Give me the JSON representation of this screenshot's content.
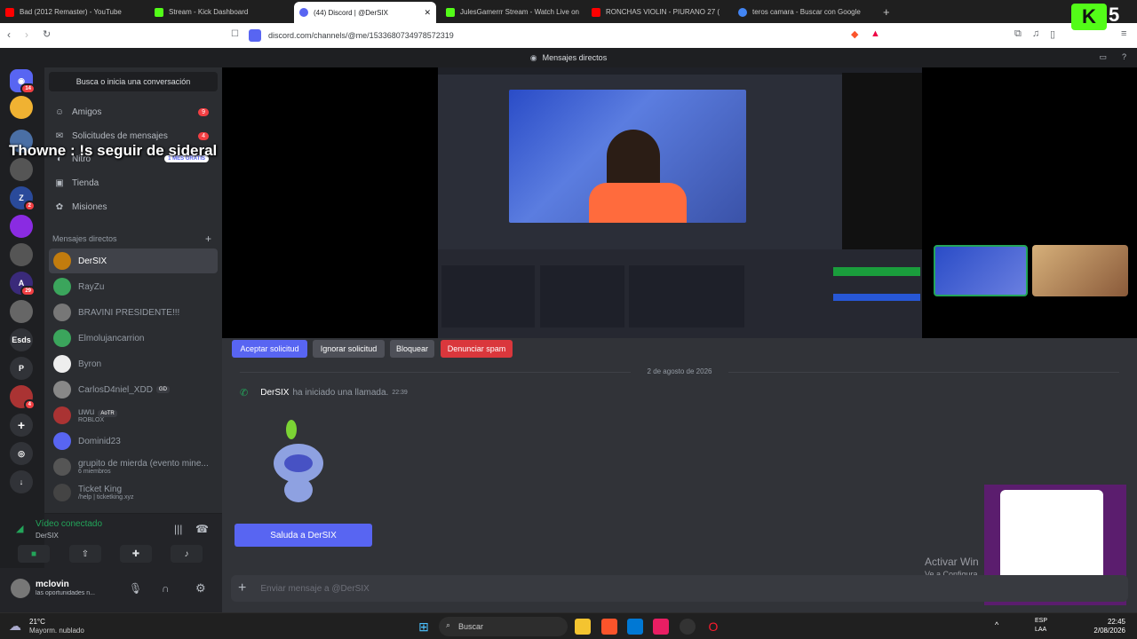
{
  "browser": {
    "tabs": [
      {
        "title": "Bad (2012 Remaster) - YouTube",
        "color": "#ff0000"
      },
      {
        "title": "Stream - Kick Dashboard",
        "color": "#53fc18"
      },
      {
        "title": "(44) Discord | @DerSIX",
        "color": "#5865f2",
        "active": true
      },
      {
        "title": "JulesGamerrr Stream - Watch Live on",
        "color": "#53fc18"
      },
      {
        "title": "RONCHAS VIOLIN - PIURANO 27 (",
        "color": "#ff0000"
      },
      {
        "title": "teros camara - Buscar con Google",
        "color": "#4285f4"
      }
    ],
    "new_tab": "+",
    "url": "discord.com/channels/@me/1533680734978572319"
  },
  "discord": {
    "title": "Mensajes directos",
    "search": "Busca o inicia una conversación",
    "nav": {
      "friends": "Amigos",
      "friends_count": "9",
      "requests": "Solicitudes de mensajes",
      "requests_count": "4",
      "nitro": "Nitro",
      "nitro_badge": "1 MES GRATIS",
      "shop": "Tienda",
      "missions": "Misiones"
    },
    "dm_header": "Mensajes directos",
    "dms": [
      {
        "name": "DerSIX",
        "selected": true,
        "color": "#c27c0e"
      },
      {
        "name": "RayZu",
        "color": "#3ba55c"
      },
      {
        "name": "BRAVINI PRESIDENTE!!!",
        "color": "#777"
      },
      {
        "name": "Elmolujancarrion",
        "color": "#3ba55c"
      },
      {
        "name": "Byron",
        "color": "#eee"
      },
      {
        "name": "CarlosD4niel_XDD",
        "tag": "GD",
        "color": "#888"
      },
      {
        "name": "uwu",
        "tag": "AoTR",
        "sub": "ROBLOX",
        "color": "#a33"
      },
      {
        "name": "Dominid23",
        "color": "#5865f2"
      },
      {
        "name": "grupito de mierda (evento mine...",
        "sub": "6 miembros",
        "color": "#555"
      },
      {
        "name": "Ticket King",
        "sub": "/help | ticketking.xyz",
        "color": "#444"
      }
    ],
    "voice": {
      "status": "Vídeo conectado",
      "channel": "DerSIX"
    },
    "user": {
      "name": "mclovin",
      "status": "las oportunidades n..."
    },
    "overlay_text": "Thowne : !s seguir de sideral",
    "actions": {
      "accept": "Aceptar solicitud",
      "ignore": "Ignorar solicitud",
      "block": "Bloquear",
      "report": "Denunciar spam"
    },
    "date": "2 de agosto de 2026",
    "call": {
      "user": "DerSIX",
      "text": "ha iniciado una llamada.",
      "time": "22:39"
    },
    "wave_button": "Saluda a DerSIX",
    "composer_placeholder": "Enviar mensaje a @DerSIX",
    "watermark": {
      "line1": "Activar Win",
      "line2": "Ve a Configura"
    }
  },
  "kick_badge": "5",
  "taskbar": {
    "weather_temp": "21°C",
    "weather_desc": "Mayorm. nublado",
    "search": "Buscar",
    "lang1": "ESP",
    "lang2": "LAA",
    "time": "22:45",
    "date": "2/08/2026"
  }
}
